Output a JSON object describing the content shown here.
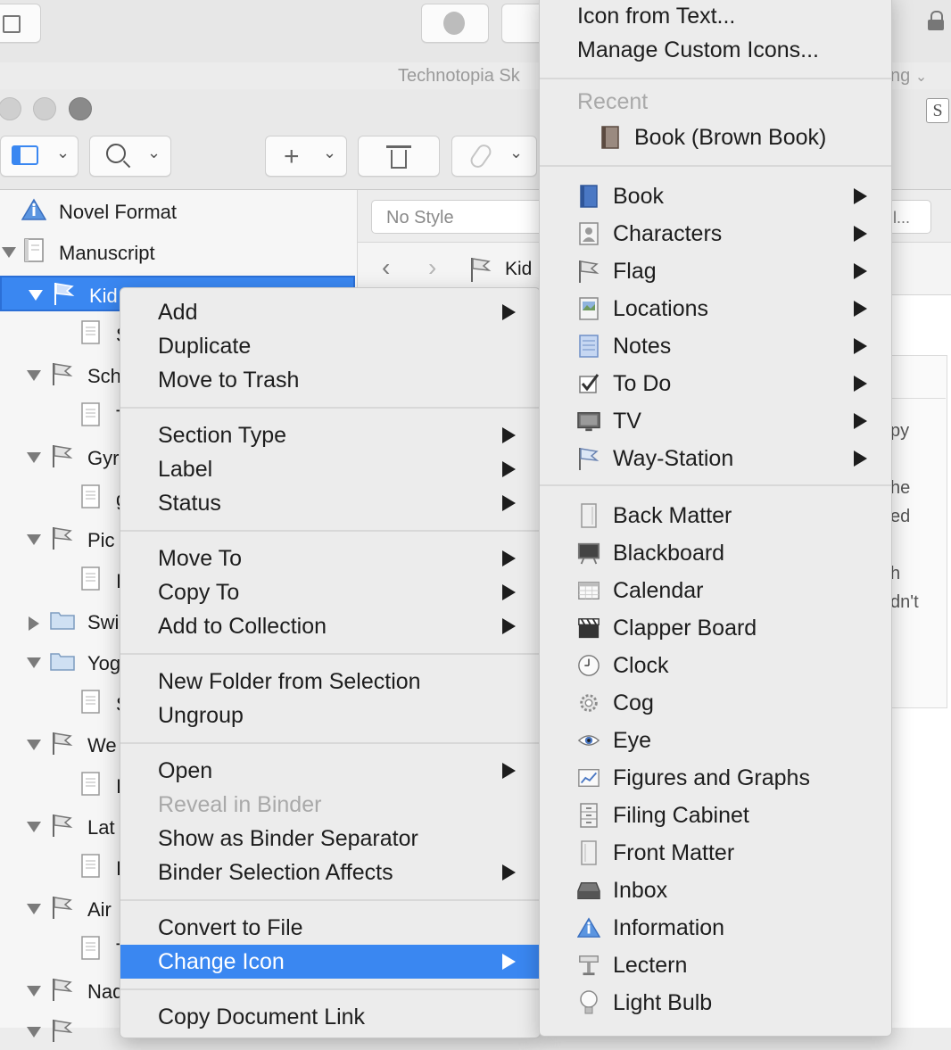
{
  "window": {
    "project_title": "Technotopia Sk",
    "title_right": "ng"
  },
  "format_bar": {
    "style": "No Style",
    "right_fragment": "l..."
  },
  "editor": {
    "nav_title": "Kid",
    "text_fragments": [
      "py",
      "he",
      "ed",
      "h",
      "dn't"
    ]
  },
  "binder": {
    "items": [
      {
        "label": "Novel Format",
        "icon": "information-icon",
        "indent": 0,
        "disclosure": "none"
      },
      {
        "label": "Manuscript",
        "icon": "manuscript-icon",
        "indent": 0,
        "disclosure": "open"
      },
      {
        "label": "Kid",
        "icon": "flag-icon",
        "indent": 1,
        "disclosure": "open",
        "selected": true
      },
      {
        "label": "S",
        "icon": "document-icon",
        "indent": 2,
        "disclosure": "none"
      },
      {
        "label": "Sch",
        "icon": "flag-icon",
        "indent": 1,
        "disclosure": "open"
      },
      {
        "label": "T",
        "icon": "document-icon",
        "indent": 2,
        "disclosure": "none"
      },
      {
        "label": "Gyr",
        "icon": "flag-icon",
        "indent": 1,
        "disclosure": "open"
      },
      {
        "label": "g",
        "icon": "document-icon",
        "indent": 2,
        "disclosure": "none"
      },
      {
        "label": "Pic",
        "icon": "flag-icon",
        "indent": 1,
        "disclosure": "open"
      },
      {
        "label": "I",
        "icon": "document-icon",
        "indent": 2,
        "disclosure": "none"
      },
      {
        "label": "Swi",
        "icon": "folder-icon",
        "indent": 1,
        "disclosure": "closed"
      },
      {
        "label": "Yog",
        "icon": "folder-icon",
        "indent": 1,
        "disclosure": "open"
      },
      {
        "label": "S",
        "icon": "document-icon",
        "indent": 2,
        "disclosure": "none"
      },
      {
        "label": "We",
        "icon": "flag-icon",
        "indent": 1,
        "disclosure": "open"
      },
      {
        "label": "I",
        "icon": "document-icon",
        "indent": 2,
        "disclosure": "none"
      },
      {
        "label": "Lat",
        "icon": "flag-icon",
        "indent": 1,
        "disclosure": "open"
      },
      {
        "label": "I",
        "icon": "document-icon",
        "indent": 2,
        "disclosure": "none"
      },
      {
        "label": "Air",
        "icon": "flag-icon",
        "indent": 1,
        "disclosure": "open"
      },
      {
        "label": "T",
        "icon": "document-icon",
        "indent": 2,
        "disclosure": "none"
      },
      {
        "label": "Nad",
        "icon": "flag-icon",
        "indent": 1,
        "disclosure": "open"
      },
      {
        "label": "",
        "icon": "flag-icon",
        "indent": 1,
        "disclosure": "open"
      }
    ]
  },
  "context_menu": {
    "groups": [
      [
        {
          "label": "Add",
          "submenu": true
        },
        {
          "label": "Duplicate"
        },
        {
          "label": "Move to Trash"
        }
      ],
      [
        {
          "label": "Section Type",
          "submenu": true
        },
        {
          "label": "Label",
          "submenu": true
        },
        {
          "label": "Status",
          "submenu": true
        }
      ],
      [
        {
          "label": "Move To",
          "submenu": true
        },
        {
          "label": "Copy To",
          "submenu": true
        },
        {
          "label": "Add to Collection",
          "submenu": true
        }
      ],
      [
        {
          "label": "New Folder from Selection"
        },
        {
          "label": "Ungroup"
        }
      ],
      [
        {
          "label": "Open",
          "submenu": true
        },
        {
          "label": "Reveal in Binder",
          "disabled": true
        },
        {
          "label": "Show as Binder Separator"
        },
        {
          "label": "Binder Selection Affects",
          "submenu": true
        }
      ],
      [
        {
          "label": "Convert to File"
        },
        {
          "label": "Change Icon",
          "submenu": true,
          "highlighted": true
        }
      ],
      [
        {
          "label": "Copy Document Link"
        }
      ]
    ]
  },
  "icon_submenu": {
    "top_items": [
      "Icon from Text...",
      "Manage Custom Icons..."
    ],
    "recent_header": "Recent",
    "recent_items": [
      {
        "label": "Book (Brown Book)",
        "icon": "book-brown-icon"
      }
    ],
    "category_items": [
      {
        "label": "Book",
        "icon": "book-icon",
        "submenu": true
      },
      {
        "label": "Characters",
        "icon": "characters-icon",
        "submenu": true
      },
      {
        "label": "Flag",
        "icon": "flag-icon",
        "submenu": true
      },
      {
        "label": "Locations",
        "icon": "locations-icon",
        "submenu": true
      },
      {
        "label": "Notes",
        "icon": "notes-icon",
        "submenu": true
      },
      {
        "label": "To Do",
        "icon": "checkbox-icon",
        "submenu": true
      },
      {
        "label": "TV",
        "icon": "tv-icon",
        "submenu": true
      },
      {
        "label": "Way-Station",
        "icon": "pennant-icon",
        "submenu": true
      }
    ],
    "icon_items": [
      {
        "label": "Back Matter",
        "icon": "back-matter-icon"
      },
      {
        "label": "Blackboard",
        "icon": "blackboard-icon"
      },
      {
        "label": "Calendar",
        "icon": "calendar-icon"
      },
      {
        "label": "Clapper Board",
        "icon": "clapper-board-icon"
      },
      {
        "label": "Clock",
        "icon": "clock-icon"
      },
      {
        "label": "Cog",
        "icon": "cog-icon"
      },
      {
        "label": "Eye",
        "icon": "eye-icon"
      },
      {
        "label": "Figures and Graphs",
        "icon": "graph-icon"
      },
      {
        "label": "Filing Cabinet",
        "icon": "filing-cabinet-icon"
      },
      {
        "label": "Front Matter",
        "icon": "front-matter-icon"
      },
      {
        "label": "Inbox",
        "icon": "inbox-icon"
      },
      {
        "label": "Information",
        "icon": "information-icon"
      },
      {
        "label": "Lectern",
        "icon": "lectern-icon"
      },
      {
        "label": "Light Bulb",
        "icon": "light-bulb-icon"
      }
    ]
  },
  "colors": {
    "selection": "#3a87f1",
    "menu_bg": "#ececec",
    "disabled_text": "#a9a9a9"
  }
}
